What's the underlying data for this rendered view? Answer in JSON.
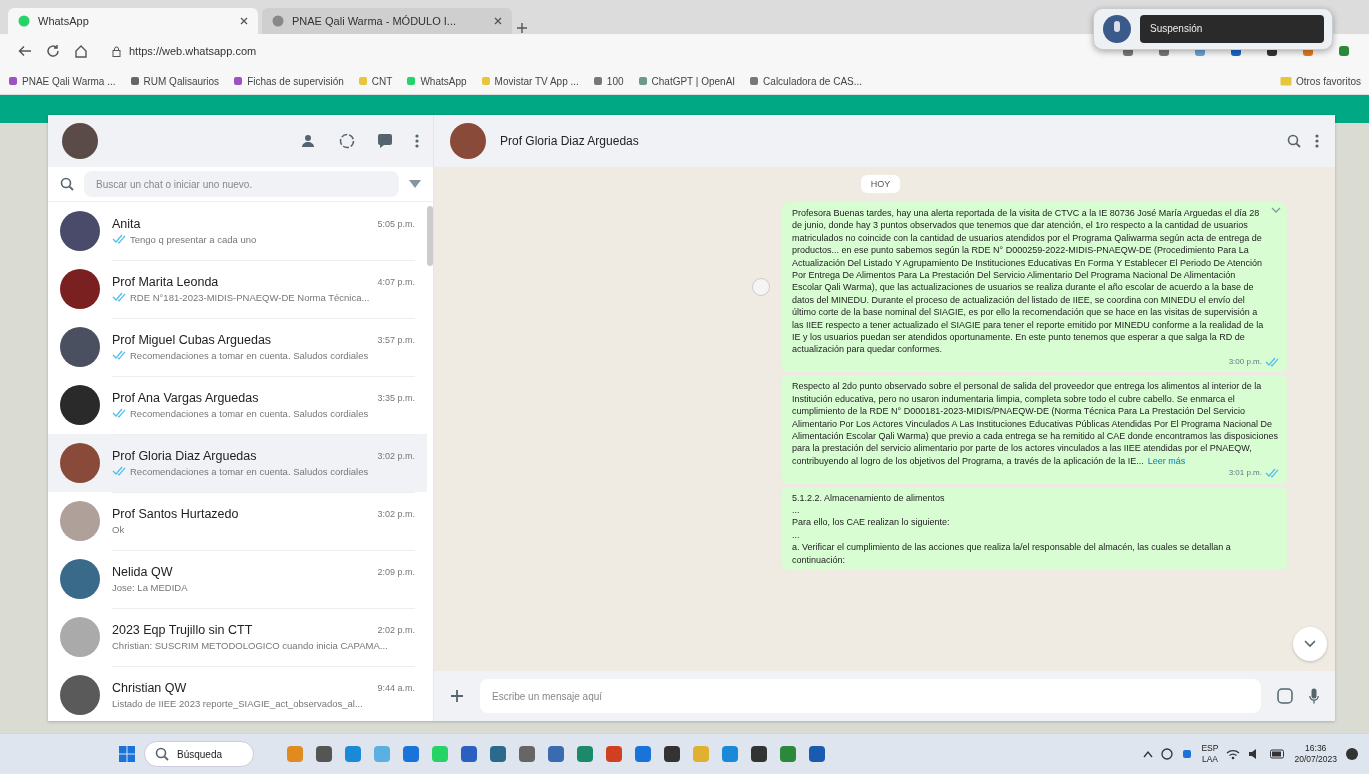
{
  "browser": {
    "tabs": [
      {
        "title": "WhatsApp",
        "selected": true
      },
      {
        "title": "PNAE Qali Warma - MÓDULO I...",
        "selected": false
      }
    ],
    "url": "https://web.whatsapp.com",
    "bookmarks": [
      "PNAE Qali Warma ...",
      "RUM Qalisaurios",
      "Fichas de supervisión",
      "CNT",
      "WhatsApp",
      "Movistar TV App ...",
      "100",
      "ChatGPT | OpenAI",
      "Calculadora de CAS..."
    ],
    "other_bookmarks": "Otros favoritos",
    "popup": "Suspensión"
  },
  "sidebar": {
    "search_placeholder": "Buscar un chat o iniciar uno nuevo.",
    "chats": [
      {
        "name": "Anita",
        "time": "5:05 p.m.",
        "preview": "Tengo q presentar a cada uno",
        "ticks": true,
        "selected": false
      },
      {
        "name": "Prof Marita Leonda",
        "time": "4:07 p.m.",
        "preview": "RDE N°181-2023-MIDIS-PNAEQW-DE Norma Técnica...",
        "ticks": true,
        "selected": false
      },
      {
        "name": "Prof Miguel Cubas Arguedas",
        "time": "3:57 p.m.",
        "preview": "Recomendaciones a tomar en cuenta. Saludos cordiales",
        "ticks": true,
        "selected": false
      },
      {
        "name": "Prof Ana Vargas Arguedas",
        "time": "3:35 p.m.",
        "preview": "Recomendaciones a tomar en cuenta. Saludos cordiales",
        "ticks": true,
        "selected": false
      },
      {
        "name": "Prof Gloria Diaz Arguedas",
        "time": "3:02 p.m.",
        "preview": "Recomendaciones a tomar en cuenta. Saludos cordiales",
        "ticks": true,
        "selected": true
      },
      {
        "name": "Prof Santos Hurtazedo",
        "time": "3:02 p.m.",
        "preview": "Ok",
        "ticks": false,
        "selected": false
      },
      {
        "name": "Nelida QW",
        "time": "2:09 p.m.",
        "preview": "Jose: La MEDIDA",
        "ticks": false,
        "selected": false
      },
      {
        "name": "2023 Eqp Trujillo sin CTT",
        "time": "2:02 p.m.",
        "preview": "Christian: SUSCRIM METODOLOGICO cuando inicia CAPAMA...",
        "ticks": false,
        "selected": false
      },
      {
        "name": "Christian QW",
        "time": "9:44 a.m.",
        "preview": "Listado de IIEE 2023 reporte_SIAGIE_act_observados_al...",
        "ticks": false,
        "selected": false
      }
    ]
  },
  "chat": {
    "contact": "Prof Gloria Diaz Arguedas",
    "date_chip": "HOY",
    "composer_placeholder": "Escribe un mensaje aquí",
    "messages": [
      {
        "text": "Profesora Buenas tardes, hay una alerta reportada de la visita de CTVC a la IE 80736 José María Arguedas el día 28 de junio, donde hay 3 puntos observados que tenemos que dar atención, el 1ro respecto a la cantidad de usuarios matriculados no coincide con la cantidad de usuarios atendidos por el Programa Qaliwarma según acta de entrega de productos... en ese punto sabemos según la RDE N° D000259-2022-MIDIS-PNAEQW-DE (Procedimiento Para La Actualización Del Listado Y Agrupamiento De Instituciones Educativas En Forma Y Establecer El Periodo De Atención Por Entrega De Alimentos Para La Prestación Del Servicio Alimentario Del Programa Nacional De Alimentación Escolar Qali Warma), que las actualizaciones de usuarios se realiza durante el año escolar de acuerdo a la base de datos del MINEDU. Durante el proceso de actualización del listado de IIEE, se coordina con MINEDU el envío del último corte de la base nominal del SIAGIE, es por ello la recomendación que se hace en las visitas de supervisión a las IIEE respecto a tener actualizado el SIAGIE para tener el reporte emitido por MINEDU conforme a la realidad de la IE y los usuarios puedan ser atendidos oportunamente. En este punto tenemos que esperar a que salga la RD de actualización para quedar conformes.",
        "time": "3:00 p.m."
      },
      {
        "text": "Respecto al 2do punto observado sobre el personal de salida del proveedor que entrega los alimentos al interior de la Institución educativa, pero no usaron indumentaria limpia, completa sobre todo el cubre cabello. Se enmarca el cumplimiento de la RDE N° D000181-2023-MIDIS/PNAEQW-DE (Norma Técnica Para La Prestación Del Servicio Alimentario Por Los Actores Vinculados A Las Instituciones Educativas Públicas Atendidas Por El Programa Nacional De Alimentación Escolar Qali Warma) que previo a cada entrega se ha remitido al CAE donde encontramos las disposiciones para la prestación del servicio alimentario por parte de los actores vinculados a las IIEE atendidas por el PNAEQW, contribuyendo al logro de los objetivos del Programa, a través de la aplicación de la IE...",
        "time": "3:01 p.m.",
        "read_more": "Leer más"
      },
      {
        "text": "5.1.2.2. Almacenamiento de alimentos\n...\nPara ello, los CAE realizan lo siguiente:\n...\na. Verificar el cumplimiento de las acciones que realiza la/el responsable del almacén, las cuales se detallan a continuación:"
      }
    ]
  },
  "taskbar": {
    "search": "Búsqueda",
    "language": "ESP",
    "layout": "LAA",
    "time": "16:36",
    "date": "20/07/2023"
  }
}
